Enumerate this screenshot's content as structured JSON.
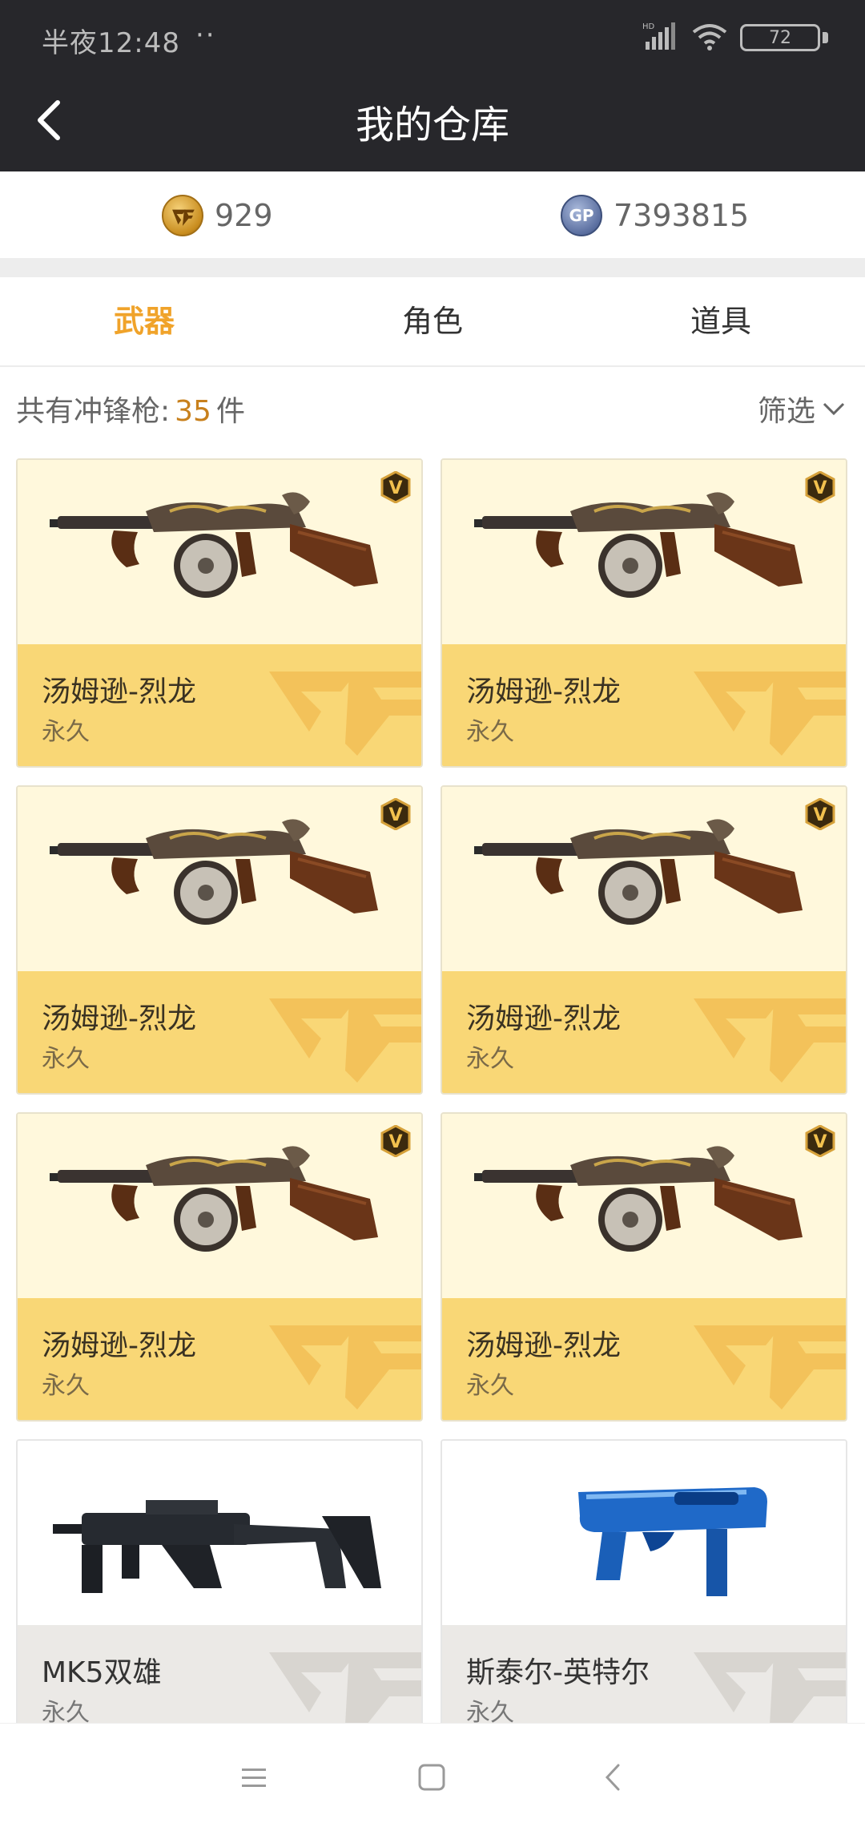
{
  "status_bar": {
    "time": "半夜12:48",
    "dots": "··",
    "battery": "72"
  },
  "header": {
    "title": "我的仓库"
  },
  "currency": {
    "cf_points": "929",
    "gp_label": "GP",
    "gp_points": "7393815"
  },
  "tabs": [
    {
      "label": "武器",
      "active": true
    },
    {
      "label": "角色",
      "active": false
    },
    {
      "label": "道具",
      "active": false
    }
  ],
  "summary": {
    "prefix": "共有冲锋枪:",
    "count": "35",
    "suffix": "件",
    "filter_label": "筛选"
  },
  "items": [
    {
      "name": "汤姆逊-烈龙",
      "duration": "永久",
      "vip": true,
      "image": "thompson-dragon-icon"
    },
    {
      "name": "汤姆逊-烈龙",
      "duration": "永久",
      "vip": true,
      "image": "thompson-dragon-icon"
    },
    {
      "name": "汤姆逊-烈龙",
      "duration": "永久",
      "vip": true,
      "image": "thompson-dragon-icon"
    },
    {
      "name": "汤姆逊-烈龙",
      "duration": "永久",
      "vip": true,
      "image": "thompson-dragon-icon"
    },
    {
      "name": "汤姆逊-烈龙",
      "duration": "永久",
      "vip": true,
      "image": "thompson-dragon-icon"
    },
    {
      "name": "汤姆逊-烈龙",
      "duration": "永久",
      "vip": true,
      "image": "thompson-dragon-icon"
    },
    {
      "name": "MK5双雄",
      "duration": "永久",
      "vip": false,
      "image": "kriss-vector-icon"
    },
    {
      "name": "斯泰尔-英特尔",
      "duration": "永久",
      "vip": false,
      "image": "steyr-intel-icon"
    }
  ],
  "colors": {
    "header_bg": "#27272b",
    "accent": "#f0a32a",
    "count": "#c8801c",
    "card_top_gold": "#fff8dc",
    "card_bottom_gold": "#f9d776",
    "card_bottom_plain": "#ebe9e6"
  }
}
